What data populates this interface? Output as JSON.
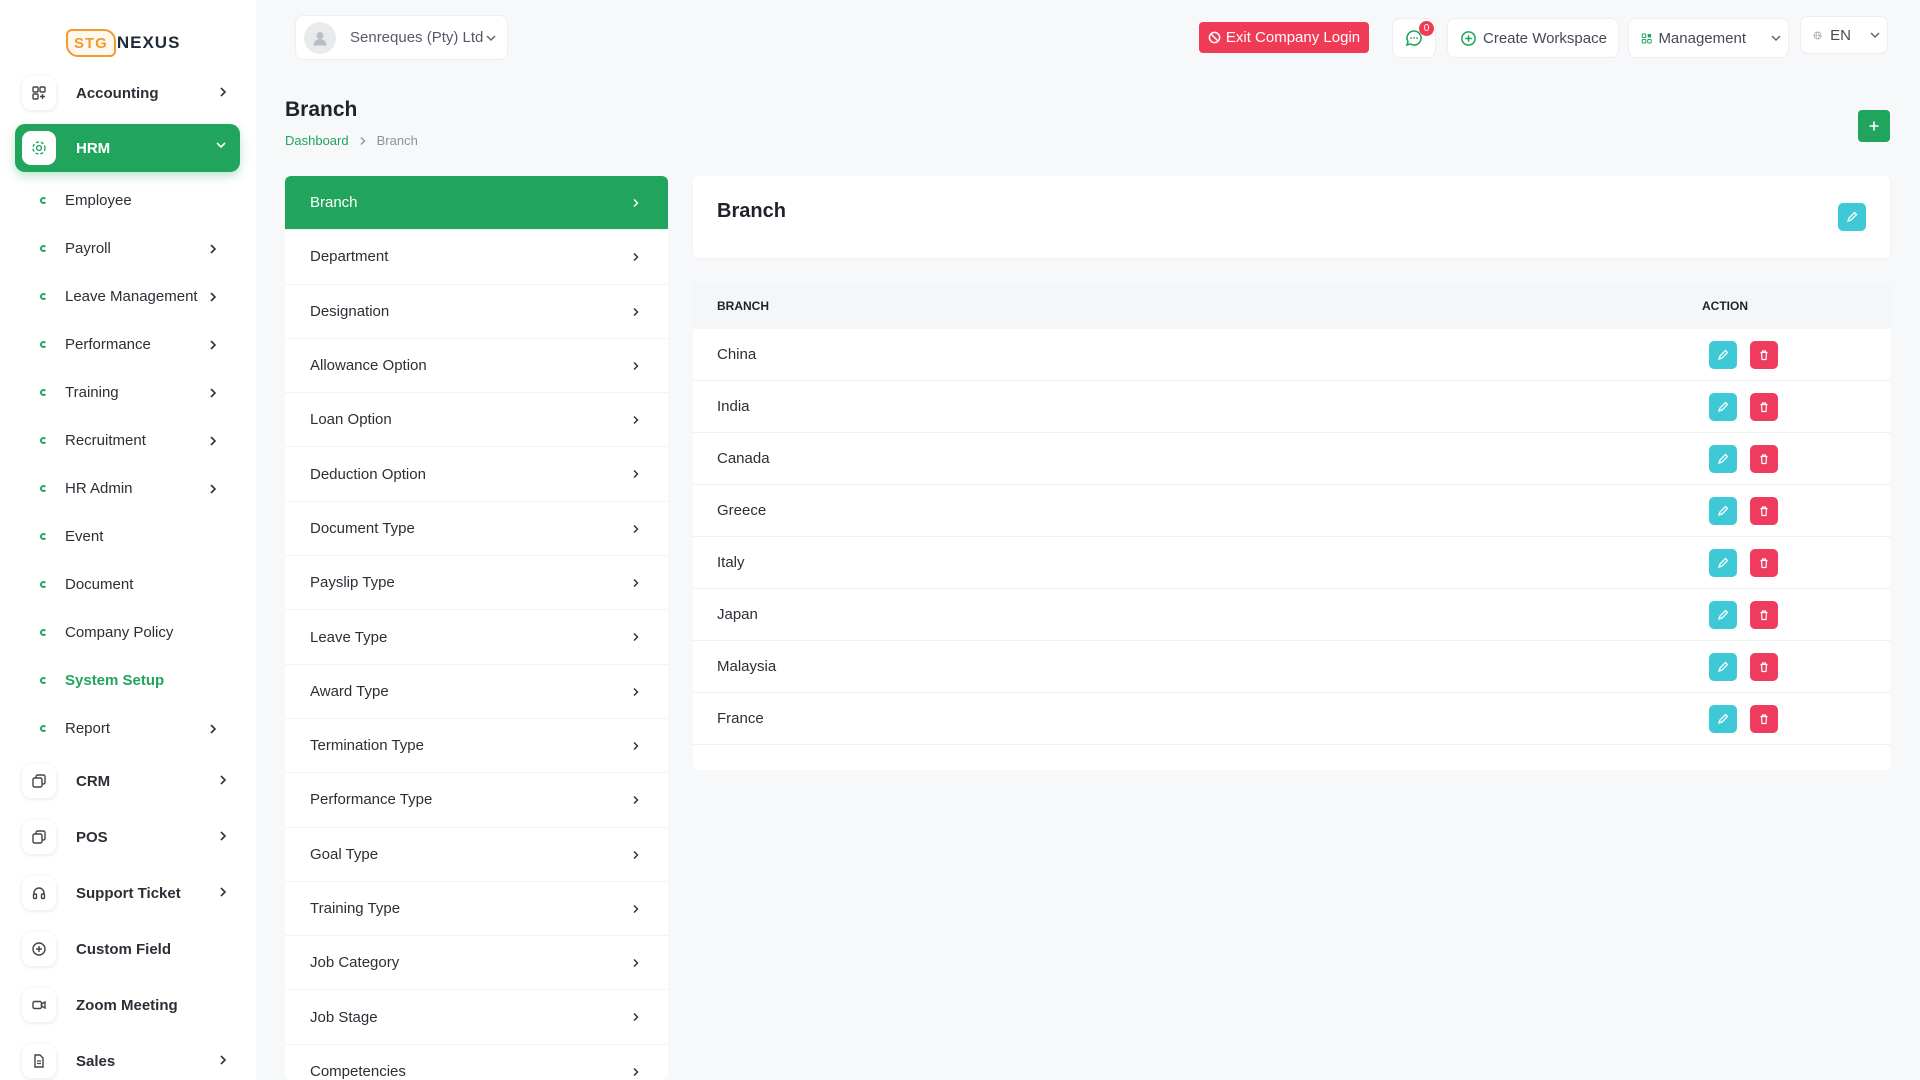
{
  "brand": {
    "badge": "STG",
    "rest": "NEXUS",
    "accent": "#21a55c",
    "danger": "#ef3b55",
    "info": "#3ec9d6"
  },
  "sidebar": {
    "accounting": "Accounting",
    "hrm": "HRM",
    "sub": [
      "Employee",
      "Payroll",
      "Leave Management",
      "Performance",
      "Training",
      "Recruitment",
      "HR Admin",
      "Event",
      "Document",
      "Company Policy",
      "System Setup",
      "Report"
    ],
    "crm": "CRM",
    "pos": "POS",
    "support": "Support Ticket",
    "custom_field": "Custom Field",
    "zoom": "Zoom Meeting",
    "sales": "Sales"
  },
  "header": {
    "company": "Senreques (Pty) Ltd",
    "exit_login": "Exit Company Login",
    "notifications": "0",
    "create_workspace": "Create Workspace",
    "management": "Management",
    "language": "EN"
  },
  "page": {
    "title": "Branch",
    "breadcrumb_home": "Dashboard",
    "breadcrumb_current": "Branch"
  },
  "setup_list": [
    "Branch",
    "Department",
    "Designation",
    "Allowance Option",
    "Loan Option",
    "Deduction Option",
    "Document Type",
    "Payslip Type",
    "Leave Type",
    "Award Type",
    "Termination Type",
    "Performance Type",
    "Goal Type",
    "Training Type",
    "Job Category",
    "Job Stage",
    "Competencies"
  ],
  "branch_card": {
    "title": "Branch"
  },
  "table": {
    "col_branch": "BRANCH",
    "col_action": "ACTION",
    "rows": [
      "China",
      "India",
      "Canada",
      "Greece",
      "Italy",
      "Japan",
      "Malaysia",
      "France"
    ]
  }
}
